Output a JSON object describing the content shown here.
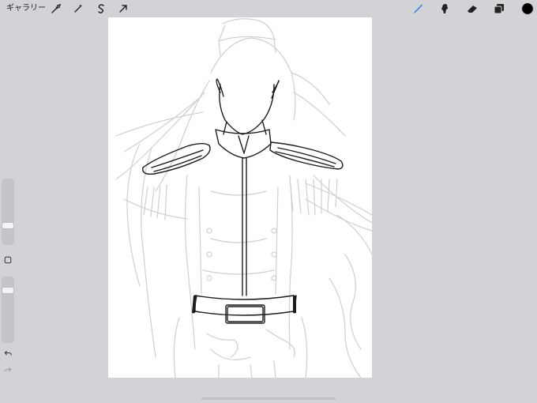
{
  "topbar": {
    "gallery_label": "ギャラリー",
    "left_tools": [
      "wrench-icon",
      "magic-wand-icon",
      "selection-s-icon",
      "transform-arrow-icon"
    ],
    "right_tools": [
      "brush-icon",
      "smudge-icon",
      "eraser-icon",
      "layers-icon",
      "color-swatch"
    ]
  },
  "colors": {
    "active_tool": "#2a7ff2",
    "current_color": "#000000",
    "background": "#d2d3d7",
    "canvas": "#ffffff"
  },
  "sidebar": {
    "brush_size_level": 0.65,
    "opacity_level": 0.18,
    "icons": [
      "modify-square-icon",
      "undo-icon",
      "redo-icon"
    ]
  }
}
